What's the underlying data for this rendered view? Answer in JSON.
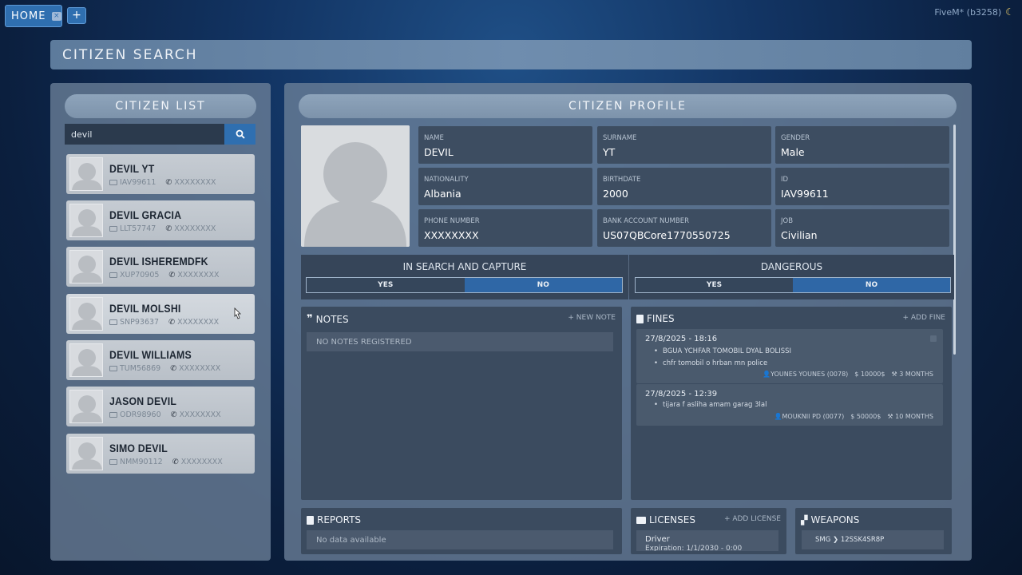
{
  "tabs": {
    "home_label": "HOME",
    "close_glyph": "×",
    "add_glyph": "+"
  },
  "build": {
    "label": "FiveM* (b3258)",
    "theme_icon": "moon-icon"
  },
  "page": {
    "title": "CITIZEN SEARCH"
  },
  "citizen_list": {
    "title": "CITIZEN LIST",
    "search_value": "devil",
    "search_icon": "search-icon",
    "items": [
      {
        "name": "DEVIL YT",
        "id": "IAV99611",
        "phone": "XXXXXXXX"
      },
      {
        "name": "DEVIL GRACIA",
        "id": "LLT57747",
        "phone": "XXXXXXXX"
      },
      {
        "name": "DEVIL ISHEREMDFK",
        "id": "XUP70905",
        "phone": "XXXXXXXX"
      },
      {
        "name": "DEVIL MOLSHI",
        "id": "SNP93637",
        "phone": "XXXXXXXX"
      },
      {
        "name": "DEVIL WILLIAMS",
        "id": "TUM56869",
        "phone": "XXXXXXXX"
      },
      {
        "name": "JASON DEVIL",
        "id": "ODR98960",
        "phone": "XXXXXXXX"
      },
      {
        "name": "SIMO DEVIL",
        "id": "NMM90112",
        "phone": "XXXXXXXX"
      }
    ]
  },
  "profile": {
    "title": "CITIZEN PROFILE",
    "fields": {
      "name": {
        "label": "NAME",
        "value": "DEVIL"
      },
      "surname": {
        "label": "SURNAME",
        "value": "YT"
      },
      "gender": {
        "label": "GENDER",
        "value": "Male"
      },
      "nationality": {
        "label": "NATIONALITY",
        "value": "Albania"
      },
      "birthdate": {
        "label": "BIRTHDATE",
        "value": "2000"
      },
      "id": {
        "label": "ID",
        "value": "IAV99611"
      },
      "phone": {
        "label": "PHONE NUMBER",
        "value": "XXXXXXXX"
      },
      "bank": {
        "label": "BANK ACCOUNT NUMBER",
        "value": "US07QBCore1770550725"
      },
      "job": {
        "label": "JOB",
        "value": "Civilian"
      }
    },
    "search_capture": {
      "title": "IN SEARCH AND CAPTURE",
      "yes": "YES",
      "no": "NO",
      "selected": "NO"
    },
    "dangerous": {
      "title": "DANGEROUS",
      "yes": "YES",
      "no": "NO",
      "selected": "NO"
    }
  },
  "notes": {
    "title": "NOTES",
    "action": "+ NEW NOTE",
    "empty": "NO NOTES REGISTERED"
  },
  "fines": {
    "title": "FINES",
    "action": "+ ADD FINE",
    "entries": [
      {
        "date": "27/8/2025 - 18:16",
        "items": [
          "BGUA YCHFAR TOMOBIL DYAL BOLISSI",
          "chfr tomobil o hrban mn police"
        ],
        "officer": "YOUNES YOUNES (0078)",
        "amount": "10000$",
        "time": "3 MONTHS"
      },
      {
        "date": "27/8/2025 - 12:39",
        "items": [
          "tijara f asliha amam garag 3lal"
        ],
        "officer": "MOUKNII PD (0077)",
        "amount": "50000$",
        "time": "10 MONTHS"
      }
    ]
  },
  "reports": {
    "title": "REPORTS",
    "empty": "No data available"
  },
  "licenses": {
    "title": "LICENSES",
    "action": "+ ADD LICENSE",
    "entry_name": "Driver",
    "entry_sub": "Expiration: 1/1/2030 - 0:00"
  },
  "weapons": {
    "title": "WEAPONS",
    "entry": "SMG ❯ 12SSK4SR8P"
  },
  "colors": {
    "accent": "#2f6fb0",
    "panel": "#6c8098",
    "card": "#3d4d61"
  }
}
